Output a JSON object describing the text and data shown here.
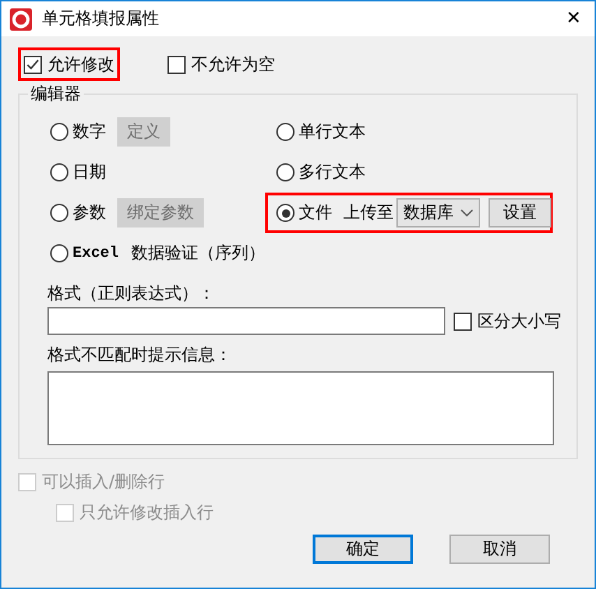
{
  "window": {
    "title": "单元格填报属性",
    "close": "✕"
  },
  "options": [
    {
      "label": "允许修改",
      "checked": true,
      "highlighted": true
    },
    {
      "label": "不允许为空",
      "checked": false,
      "highlighted": false
    }
  ],
  "editor": {
    "title": "编辑器",
    "rows": [
      [
        {
          "label": "数字",
          "selected": false,
          "button": {
            "label": "定义",
            "disabled": true
          }
        },
        {
          "label": "单行文本",
          "selected": false
        }
      ],
      [
        {
          "label": "日期",
          "selected": false
        },
        {
          "label": "多行文本",
          "selected": false
        }
      ],
      [
        {
          "label": "参数",
          "selected": false,
          "button": {
            "label": "绑定参数",
            "disabled": true
          }
        },
        {
          "label": "文件",
          "selected": true,
          "highlighted": true,
          "upload": {
            "label": "上传至",
            "value": "数据库",
            "button": "设置"
          }
        }
      ],
      [
        {
          "label": "Excel",
          "label_2": "数据验证（序列）",
          "selected": false
        }
      ]
    ],
    "format": {
      "label": "格式（正则表达式）：",
      "case_option": {
        "label": "区分大小写",
        "checked": false
      }
    },
    "message": {
      "label": "格式不匹配时提示信息："
    }
  },
  "row_options": [
    {
      "label": "可以插入/删除行",
      "checked": false,
      "disabled": true,
      "children": [
        {
          "label": "只允许修改插入行",
          "checked": false,
          "disabled": true
        }
      ]
    }
  ],
  "buttons": [
    {
      "label": "确定",
      "default": true
    },
    {
      "label": "取消",
      "default": false
    }
  ]
}
